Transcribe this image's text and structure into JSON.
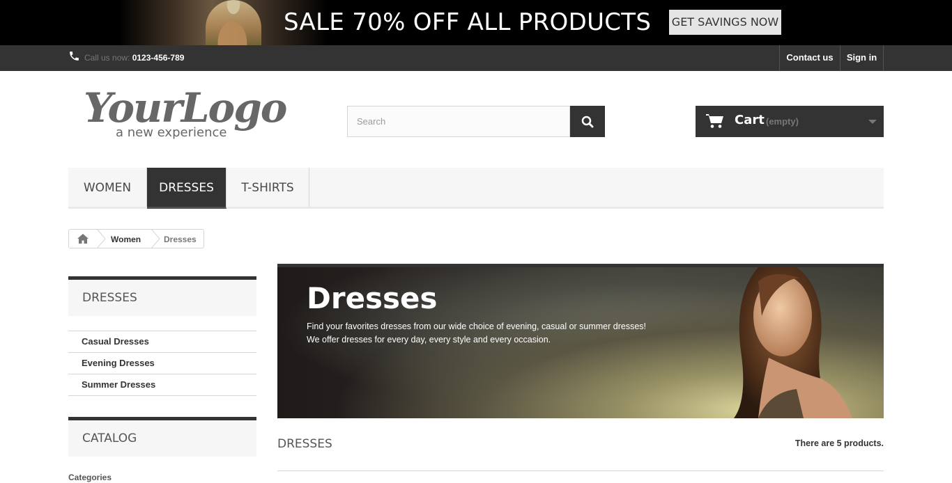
{
  "promo": {
    "text": "SALE 70% OFF ALL PRODUCTS",
    "button": "GET SAVINGS NOW"
  },
  "topnav": {
    "call_label": "Call us now: ",
    "phone": "0123-456-789",
    "contact": "Contact us",
    "signin": "Sign in"
  },
  "logo": {
    "script": "YourLogo",
    "tagline": "a new experience"
  },
  "search": {
    "placeholder": "Search",
    "value": ""
  },
  "cart": {
    "label": "Cart",
    "status": "(empty)"
  },
  "menu": {
    "items": [
      {
        "label": "Women"
      },
      {
        "label": "Dresses"
      },
      {
        "label": "T-shirts"
      }
    ]
  },
  "breadcrumb": {
    "parent": "Women",
    "current": "Dresses"
  },
  "sidebar": {
    "dresses_title": "Dresses",
    "subcategories": [
      "Casual Dresses",
      "Evening Dresses",
      "Summer Dresses"
    ],
    "catalog_title": "Catalog",
    "categories_label": "Categories"
  },
  "category": {
    "title": "Dresses",
    "desc_line1": "Find your favorites dresses from our wide choice of evening, casual or summer dresses!",
    "desc_line2": "We offer dresses for every day, every style and every occasion."
  },
  "listing": {
    "heading": "Dresses",
    "count_text": "There are 5 products."
  },
  "colors": {
    "dark": "#333333",
    "menu_bg": "#f6f6f6",
    "border": "#d6d4d4"
  }
}
